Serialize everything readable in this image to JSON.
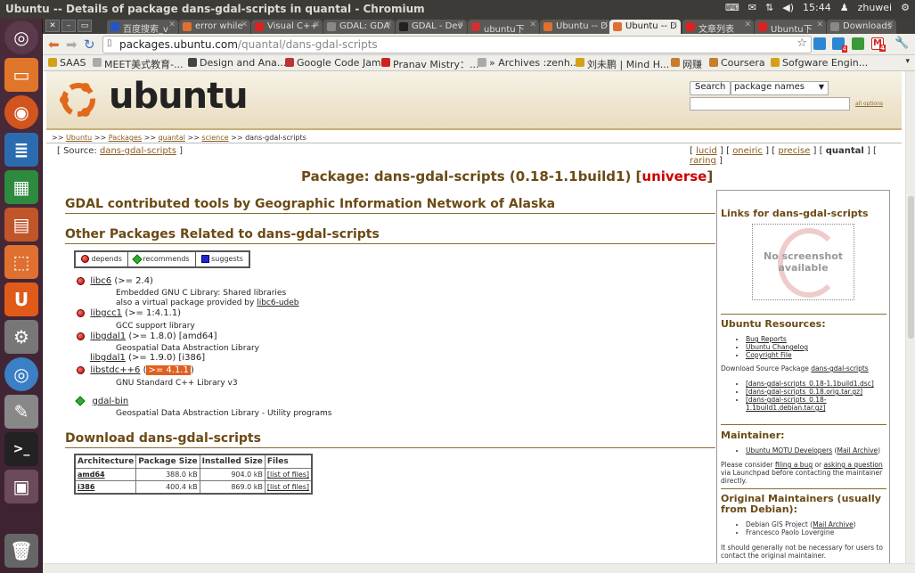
{
  "window": {
    "title": "Ubuntu -- Details of package dans-gdal-scripts in quantal - Chromium"
  },
  "tray": {
    "time": "15:44",
    "user": "zhuwei"
  },
  "tabs": [
    {
      "label": "百度搜索_v",
      "color": "#2255cc"
    },
    {
      "label": "error while",
      "color": "#e07030"
    },
    {
      "label": "Visual C++",
      "color": "#d22"
    },
    {
      "label": "GDAL: GDA",
      "color": "#888"
    },
    {
      "label": "GDAL - Dev",
      "color": "#222"
    },
    {
      "label": "ubuntu下",
      "color": "#c33"
    },
    {
      "label": "Ubuntu -- D",
      "color": "#e07030"
    },
    {
      "label": "Ubuntu -- D",
      "color": "#e07030",
      "active": true
    },
    {
      "label": "文章列表",
      "color": "#d22"
    },
    {
      "label": "Ubuntu下",
      "color": "#d22"
    },
    {
      "label": "Downloads",
      "color": "#888"
    }
  ],
  "omnibox": {
    "host": "packages.ubuntu.com",
    "path": "/quantal/dans-gdal-scripts"
  },
  "toolbar_badges": {
    "mail": "4",
    "gmail": "4"
  },
  "bookmarks": [
    {
      "label": "SAAS",
      "color": "#d4a017"
    },
    {
      "label": "MEET美式教育-...",
      "color": "#aaa"
    },
    {
      "label": "Design and Ana...",
      "color": "#444"
    },
    {
      "label": "Google Code Jam",
      "color": "#b33"
    },
    {
      "label": "Pranav Mistry：...",
      "color": "#c22"
    },
    {
      "label": "» Archives :zenh...",
      "color": "#aaa"
    },
    {
      "label": "刘未鹏 | Mind H...",
      "color": "#d4a017"
    },
    {
      "label": "网赚",
      "color": "#c77d2a"
    },
    {
      "label": "Coursera",
      "color": "#c77d2a"
    },
    {
      "label": "Sofgware Engin...",
      "color": "#d4a017"
    }
  ],
  "header": {
    "logo_text": "ubuntu",
    "search_button": "Search",
    "search_select": "package names",
    "all_options": "all options"
  },
  "breadcrumbs": {
    "prefix": ">>",
    "ubuntu": "Ubuntu",
    "packages": "Packages",
    "quantal": "quantal",
    "science": "science",
    "current": "dans-gdal-scripts",
    "sep": ">>"
  },
  "source": {
    "label": "[ Source:",
    "pkg": "dans-gdal-scripts",
    "close": "]"
  },
  "dists": {
    "lucid": "lucid",
    "oneiric": "oneiric",
    "precise": "precise",
    "quantal": "quantal",
    "raring": "raring"
  },
  "package": {
    "title": "Package: dans-gdal-scripts (0.18-1.1build1) [",
    "universe": "universe",
    "close": "]"
  },
  "description_heading": "GDAL contributed tools by Geographic Information Network of Alaska",
  "related_heading": "Other Packages Related to dans-gdal-scripts",
  "legend": {
    "depends": "depends",
    "recommends": "recommends",
    "suggests": "suggests"
  },
  "deps": [
    {
      "name": "libc6",
      "version": "(>= 2.4)",
      "desc1": "Embedded GNU C Library: Shared libraries",
      "desc2_prefix": "also a virtual package provided by ",
      "desc2_link": "libc6-udeb"
    },
    {
      "name": "libgcc1",
      "version": "(>= 1:4.1.1)",
      "desc1": "GCC support library"
    },
    {
      "name": "libgdal1",
      "version": "(>= 1.8.0) [amd64]",
      "desc1": "Geospatial Data Abstraction Library"
    },
    {
      "name": "libgdal1",
      "version": "(>= 1.9.0) [i386]"
    },
    {
      "name": "libstdc++6",
      "version_open": "(",
      "version_hl": ">= 4.1.1",
      "version_close": ")",
      "desc1": "GNU Standard C++ Library v3"
    },
    {
      "name": "gdal-bin",
      "desc1": "Geospatial Data Abstraction Library - Utility programs"
    }
  ],
  "download_heading": "Download dans-gdal-scripts",
  "download_table": {
    "headers": [
      "Architecture",
      "Package Size",
      "Installed Size",
      "Files"
    ],
    "rows": [
      [
        "amd64",
        "388.0 kB",
        "904.0 kB",
        "[list of files]"
      ],
      [
        "i386",
        "400.4 kB",
        "869.0 kB",
        "[list of files]"
      ]
    ]
  },
  "sidebar": {
    "links_title": "Links for dans-gdal-scripts",
    "no_screenshot": "No screenshot available",
    "resources_title": "Ubuntu Resources:",
    "resources": [
      "Bug Reports",
      "Ubuntu Changelog",
      "Copyright File"
    ],
    "download_source_prefix": "Download Source Package ",
    "download_source_link": "dans-gdal-scripts",
    "source_files": [
      "[dans-gdal-scripts_0.18-1.1build1.dsc]",
      "[dans-gdal-scripts_0.18.orig.tar.gz]",
      "[dans-gdal-scripts_0.18-",
      "1.1build1.debian.tar.gz]"
    ],
    "maintainer_title": "Maintainer:",
    "maintainer_name": "Ubuntu MOTU Developers",
    "maintainer_mail": "Mail Archive",
    "consider_1": "Please consider ",
    "filing_bug": "filing a bug",
    "consider_2": " or ",
    "asking_question": "asking a question",
    "consider_3": " via Launchpad before contacting the maintainer directly.",
    "orig_title": "Original Maintainers (usually from Debian):",
    "orig_1": "Debian GIS Project",
    "orig_1_mail": "Mail Archive",
    "orig_2": "Francesco Paolo Lovergine",
    "footer_text": "It should generally not be necessary for users to contact the original maintainer."
  }
}
